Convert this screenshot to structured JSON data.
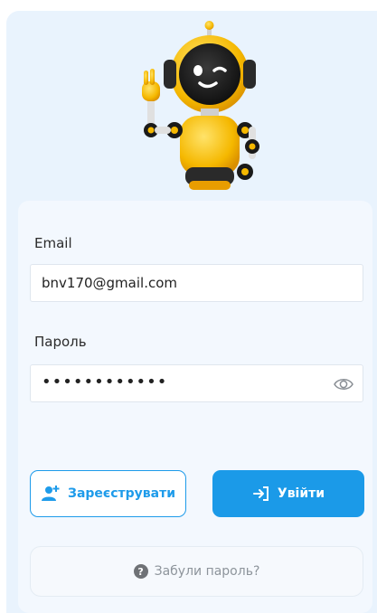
{
  "mascot": {
    "icon": "robot-mascot-icon"
  },
  "form": {
    "email_label": "Email",
    "email_value": "bnv170@gmail.com",
    "password_label": "Пароль",
    "password_value": "••••••••••••",
    "show_password_icon": "eye-icon"
  },
  "actions": {
    "register_label": "Зареєструвати",
    "register_icon": "add-user-icon",
    "login_label": "Увійти",
    "login_icon": "login-arrow-icon",
    "forgot_label": "Забули пароль?",
    "forgot_icon": "question-icon"
  },
  "colors": {
    "accent": "#1b9ae8",
    "panel_bg": "#e9f3fd",
    "card_bg": "#f3f8fe"
  }
}
